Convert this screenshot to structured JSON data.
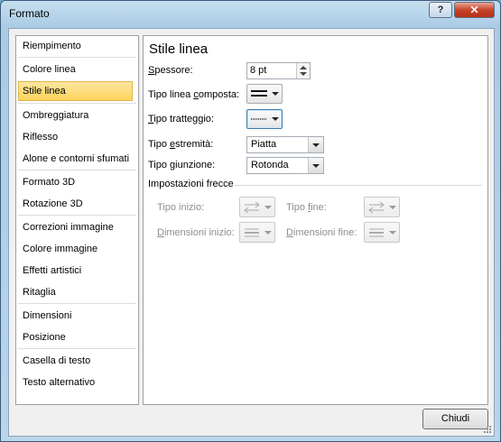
{
  "window": {
    "title": "Formato",
    "help_label": "?",
    "close_label": "✕"
  },
  "sidebar": {
    "items": [
      {
        "label": "Riempimento"
      },
      {
        "label": "Colore linea"
      },
      {
        "label": "Stile linea"
      },
      {
        "label": "Ombreggiatura"
      },
      {
        "label": "Riflesso"
      },
      {
        "label": "Alone e contorni sfumati"
      },
      {
        "label": "Formato 3D"
      },
      {
        "label": "Rotazione 3D"
      },
      {
        "label": "Correzioni immagine"
      },
      {
        "label": "Colore immagine"
      },
      {
        "label": "Effetti artistici"
      },
      {
        "label": "Ritaglia"
      },
      {
        "label": "Dimensioni"
      },
      {
        "label": "Posizione"
      },
      {
        "label": "Casella di testo"
      },
      {
        "label": "Testo alternativo"
      }
    ],
    "selected": "Stile linea"
  },
  "panel": {
    "title": "Stile linea",
    "spessore": {
      "label_u": "S",
      "label_rest": "pessore:",
      "value": "8 pt"
    },
    "tipo_linea_composta": {
      "label_pre": "Tipo linea ",
      "label_u": "c",
      "label_rest": "omposta:"
    },
    "tipo_tratteggio": {
      "label_u": "T",
      "label_rest": "ipo tratteggio:"
    },
    "tipo_estremita": {
      "label_pre": "Tipo ",
      "label_u": "e",
      "label_rest": "stremità:",
      "value": "Piatta"
    },
    "tipo_giunzione": {
      "label_pre": "Tipo ",
      "label_u": "g",
      "label_rest": "iunzione:",
      "value": "Rotonda"
    },
    "arrows": {
      "group_label": "Impostazioni frecce",
      "tipo_inizio": "Tipo inizio:",
      "tipo_fine_pre": "Tipo ",
      "tipo_fine_u": "f",
      "tipo_fine_rest": "ine:",
      "dim_inizio_u": "D",
      "dim_inizio_rest": "imensioni inizio:",
      "dim_fine_u": "D",
      "dim_fine_rest": "imensioni fine:"
    }
  },
  "footer": {
    "close_label": "Chiudi"
  }
}
